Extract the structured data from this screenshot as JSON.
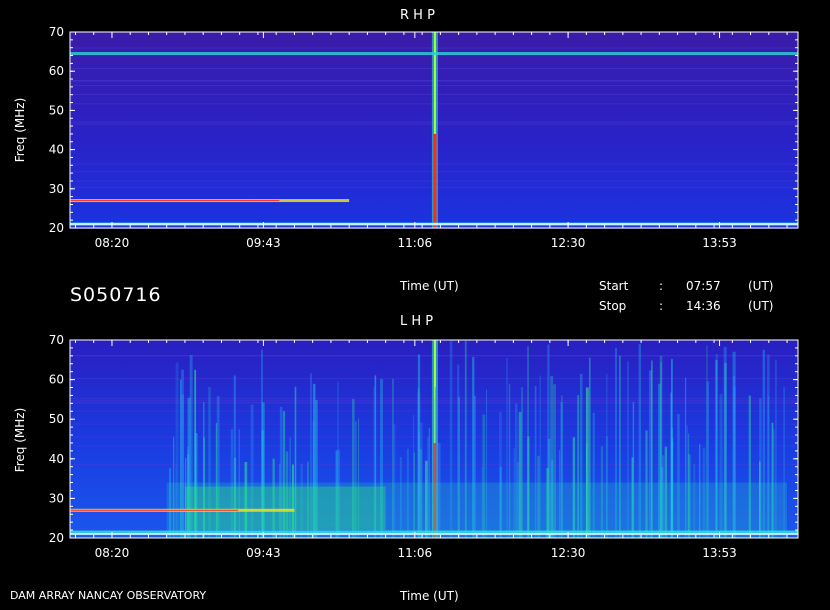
{
  "header": {
    "rhp_title": "R H P",
    "lhp_title": "L H P",
    "obs_id": "S050716",
    "time_label_top": "Time (UT)",
    "time_label_bottom": "Time (UT)",
    "start_label": "Start",
    "start_colon": ":",
    "start_time": "07:57",
    "start_unit": "(UT)",
    "stop_label": "Stop",
    "stop_colon": ":",
    "stop_time": "14:36",
    "stop_unit": "(UT)",
    "footer_left": "DAM ARRAY   NANCAY OBSERVATORY"
  },
  "colors": {
    "background": "#000000",
    "plot_base": "#3a1aa6",
    "text": "#ffffff"
  },
  "chart_data": [
    {
      "type": "heatmap",
      "title": "R H P",
      "xlabel": "Time (UT)",
      "ylabel": "Freq (MHz)",
      "xlim": [
        "07:57",
        "14:36"
      ],
      "ylim": [
        20,
        70
      ],
      "x_tick_labels": [
        "08:20",
        "09:43",
        "11:06",
        "12:30",
        "13:53"
      ],
      "y_tick_labels": [
        "20",
        "30",
        "40",
        "50",
        "60",
        "70"
      ],
      "features": [
        {
          "kind": "burst",
          "time": "11:17",
          "freq_range": [
            20,
            70
          ],
          "intensity": "high"
        },
        {
          "kind": "band",
          "freq": 27,
          "time_range": [
            "07:57",
            "10:30"
          ],
          "intensity": "high"
        },
        {
          "kind": "band",
          "freq": 21,
          "time_range": [
            "07:57",
            "14:36"
          ],
          "intensity": "medium"
        },
        {
          "kind": "band",
          "freq": 64.5,
          "time_range": [
            "07:57",
            "14:36"
          ],
          "intensity": "low"
        }
      ]
    },
    {
      "type": "heatmap",
      "title": "L H P",
      "xlabel": "Time (UT)",
      "ylabel": "Freq (MHz)",
      "xlim": [
        "07:57",
        "14:36"
      ],
      "ylim": [
        20,
        70
      ],
      "x_tick_labels": [
        "08:20",
        "09:43",
        "11:06",
        "12:30",
        "13:53"
      ],
      "y_tick_labels": [
        "20",
        "30",
        "40",
        "50",
        "60",
        "70"
      ],
      "features": [
        {
          "kind": "burst",
          "time": "11:17",
          "freq_range": [
            20,
            70
          ],
          "intensity": "high"
        },
        {
          "kind": "storm",
          "time_range": [
            "08:50",
            "14:30"
          ],
          "freq_range": [
            20,
            50
          ],
          "intensity": "medium"
        },
        {
          "kind": "band",
          "freq": 27,
          "time_range": [
            "07:57",
            "10:00"
          ],
          "intensity": "high"
        },
        {
          "kind": "band",
          "freq": 21.5,
          "time_range": [
            "07:57",
            "14:36"
          ],
          "intensity": "medium"
        }
      ]
    }
  ]
}
